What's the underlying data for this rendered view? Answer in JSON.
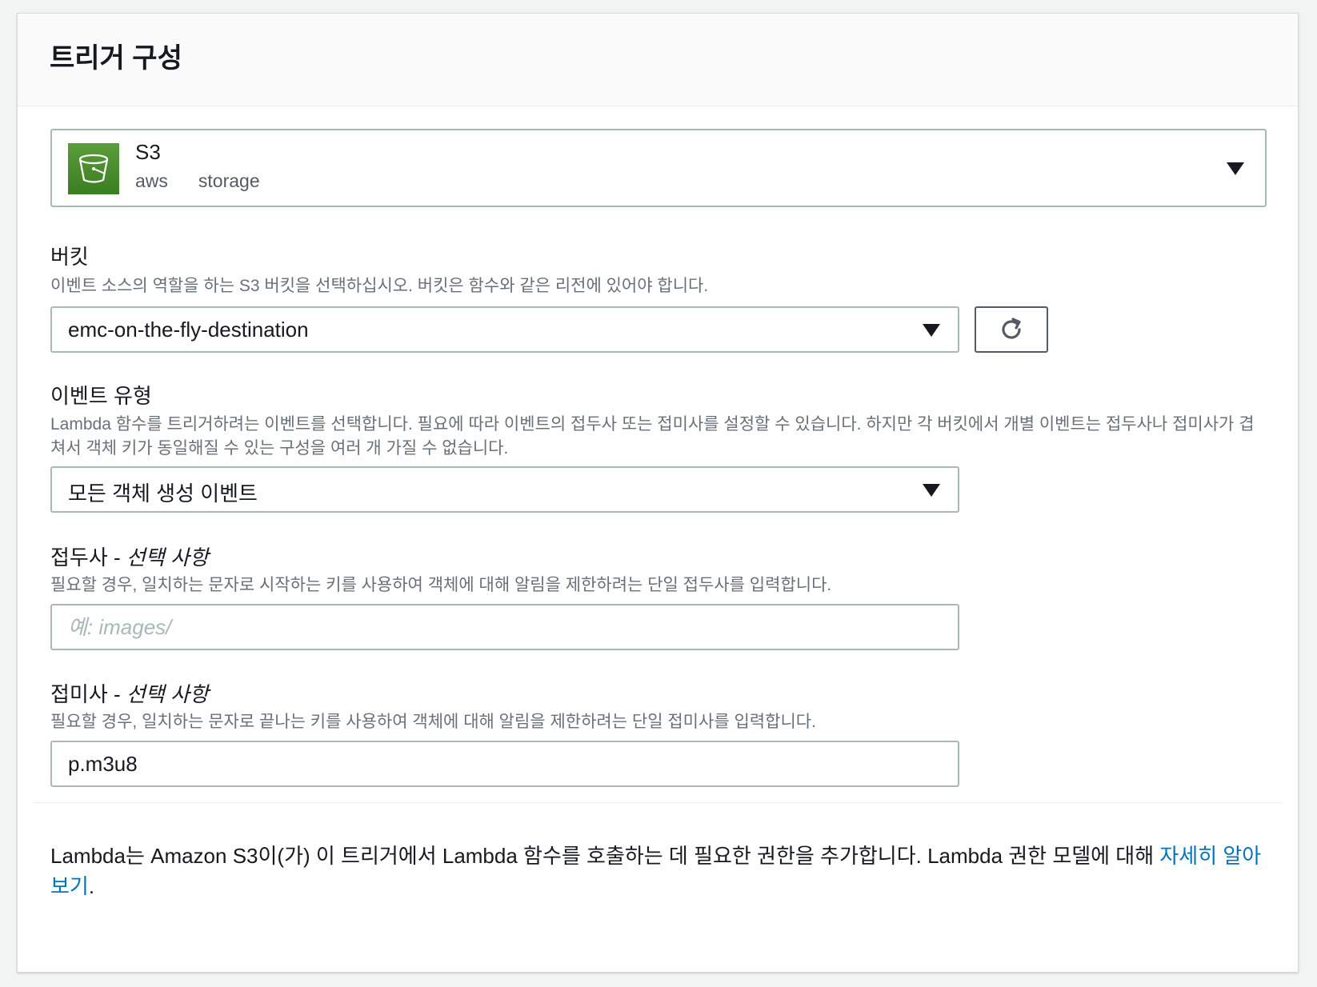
{
  "panel": {
    "title": "트리거 구성"
  },
  "service": {
    "name": "S3",
    "tags": [
      "aws",
      "storage"
    ],
    "icon": "s3-bucket-icon",
    "icon_color": "#4c8f2d"
  },
  "bucket": {
    "label": "버킷",
    "description": "이벤트 소스의 역할을 하는 S3 버킷을 선택하십시오. 버킷은 함수와 같은 리전에 있어야 합니다.",
    "selected": "emc-on-the-fly-destination",
    "refresh_icon": "refresh-icon"
  },
  "event_type": {
    "label": "이벤트 유형",
    "description": "Lambda 함수를 트리거하려는 이벤트를 선택합니다. 필요에 따라 이벤트의 접두사 또는 접미사를 설정할 수 있습니다. 하지만 각 버킷에서 개별 이벤트는 접두사나 접미사가 겹쳐서 객체 키가 동일해질 수 있는 구성을 여러 개 가질 수 없습니다.",
    "selected": "모든 객체 생성 이벤트"
  },
  "prefix": {
    "label": "접두사 - ",
    "optional": "선택 사항",
    "description": "필요할 경우, 일치하는 문자로 시작하는 키를 사용하여 객체에 대해 알림을 제한하려는 단일 접두사를 입력합니다.",
    "placeholder": "예: images/",
    "value": ""
  },
  "suffix": {
    "label": "접미사 - ",
    "optional": "선택 사항",
    "description": "필요할 경우, 일치하는 문자로 끝나는 키를 사용하여 객체에 대해 알림을 제한하려는 단일 접미사를 입력합니다.",
    "placeholder": "",
    "value": "p.m3u8"
  },
  "footer": {
    "text": "Lambda는 Amazon S3이(가) 이 트리거에서 Lambda 함수를 호출하는 데 필요한 권한을 추가합니다. Lambda 권한 모델에 대해 ",
    "link_text": "자세히 알아보기",
    "period": ".",
    "link_color": "#0073bb"
  }
}
